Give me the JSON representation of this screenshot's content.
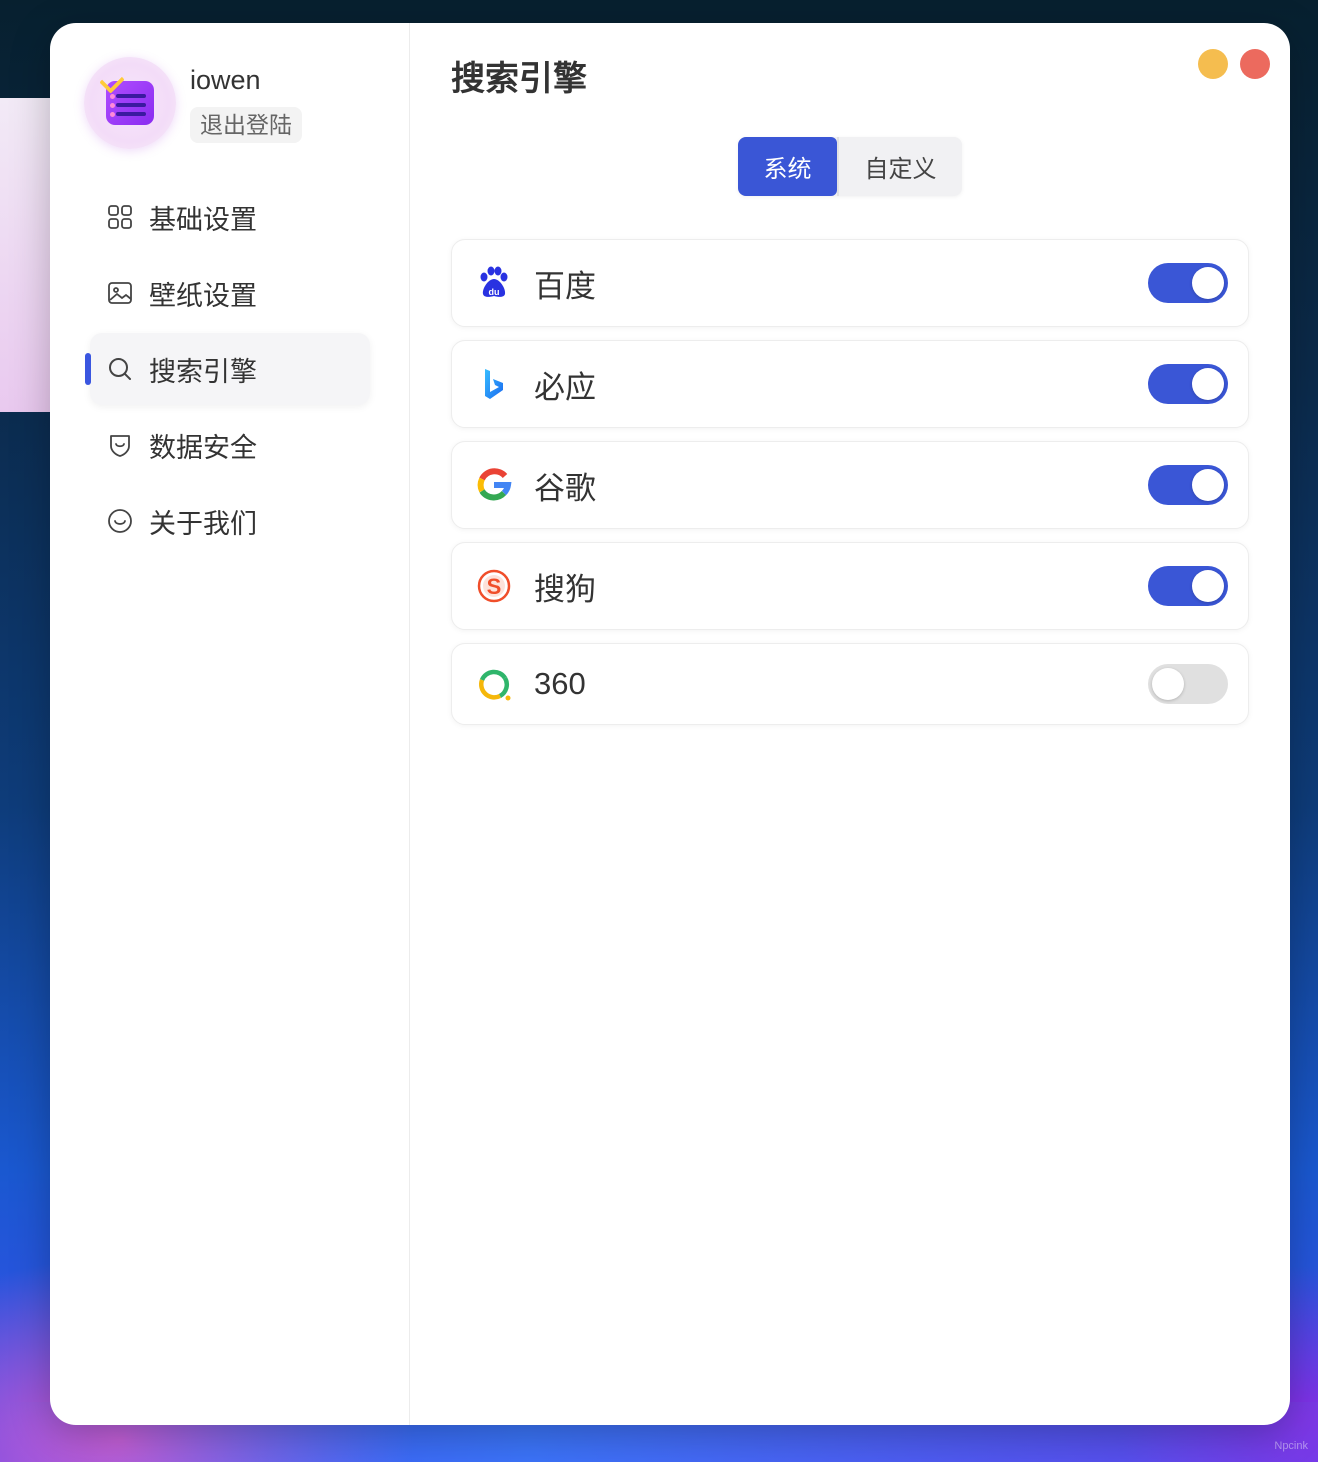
{
  "user": {
    "name": "iowen",
    "logout_label": "退出登陆"
  },
  "sidebar": {
    "items": [
      {
        "label": "基础设置",
        "icon": "grid-icon",
        "active": false
      },
      {
        "label": "壁纸设置",
        "icon": "image-icon",
        "active": false
      },
      {
        "label": "搜索引擎",
        "icon": "search-icon",
        "active": true
      },
      {
        "label": "数据安全",
        "icon": "shield-icon",
        "active": false
      },
      {
        "label": "关于我们",
        "icon": "smile-icon",
        "active": false
      }
    ]
  },
  "main": {
    "title": "搜索引擎",
    "tabs": [
      {
        "label": "系统",
        "active": true
      },
      {
        "label": "自定义",
        "active": false
      }
    ],
    "engines": [
      {
        "name": "百度",
        "logo": "baidu-logo-icon",
        "enabled": true
      },
      {
        "name": "必应",
        "logo": "bing-logo-icon",
        "enabled": true
      },
      {
        "name": "谷歌",
        "logo": "google-logo-icon",
        "enabled": true
      },
      {
        "name": "搜狗",
        "logo": "sogou-logo-icon",
        "enabled": true
      },
      {
        "name": "360",
        "logo": "360-logo-icon",
        "enabled": false
      }
    ]
  },
  "watermark": "Npcink",
  "colors": {
    "accent": "#3a56d6",
    "minimize": "#f5bd4f",
    "close": "#ec6a5e"
  }
}
